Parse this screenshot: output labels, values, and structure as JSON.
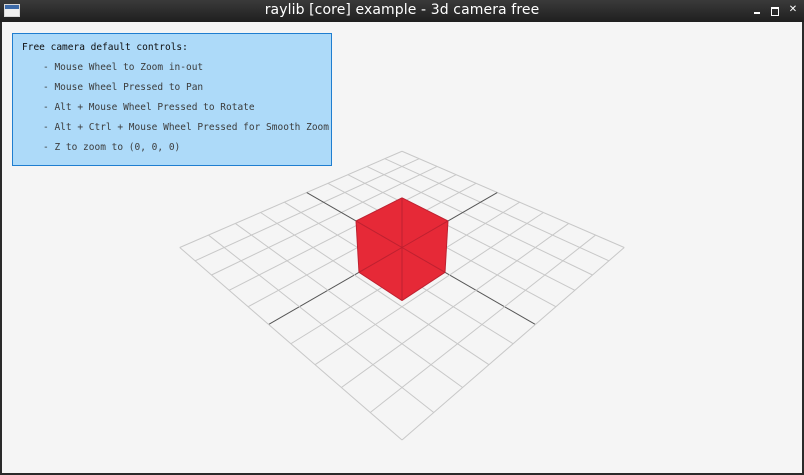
{
  "window": {
    "title": "raylib [core] example - 3d camera free",
    "buttons": [
      "minimize",
      "maximize",
      "close"
    ]
  },
  "info_panel": {
    "title": "Free camera default controls:",
    "lines": [
      "- Mouse Wheel to Zoom in-out",
      "- Mouse Wheel Pressed to Pan",
      "- Alt + Mouse Wheel Pressed to Rotate",
      "- Alt + Ctrl + Mouse Wheel Pressed for Smooth Zoom",
      "- Z to zoom to (0, 0, 0)"
    ]
  },
  "scene": {
    "background_color": "#f5f5f5",
    "grid_color": "#c8c8c8",
    "axis_color": "#555555",
    "cube_color": "#e62937",
    "cube_wire_color": "#be2130",
    "grid_slices": 10,
    "grid_spacing": 1,
    "cube_size": 2,
    "cube_position": [
      0,
      0,
      0
    ]
  },
  "colors": {
    "titlebar": "#1f1f1f",
    "panel_fill": "#99d2fa",
    "panel_border": "#1f7ed0"
  }
}
